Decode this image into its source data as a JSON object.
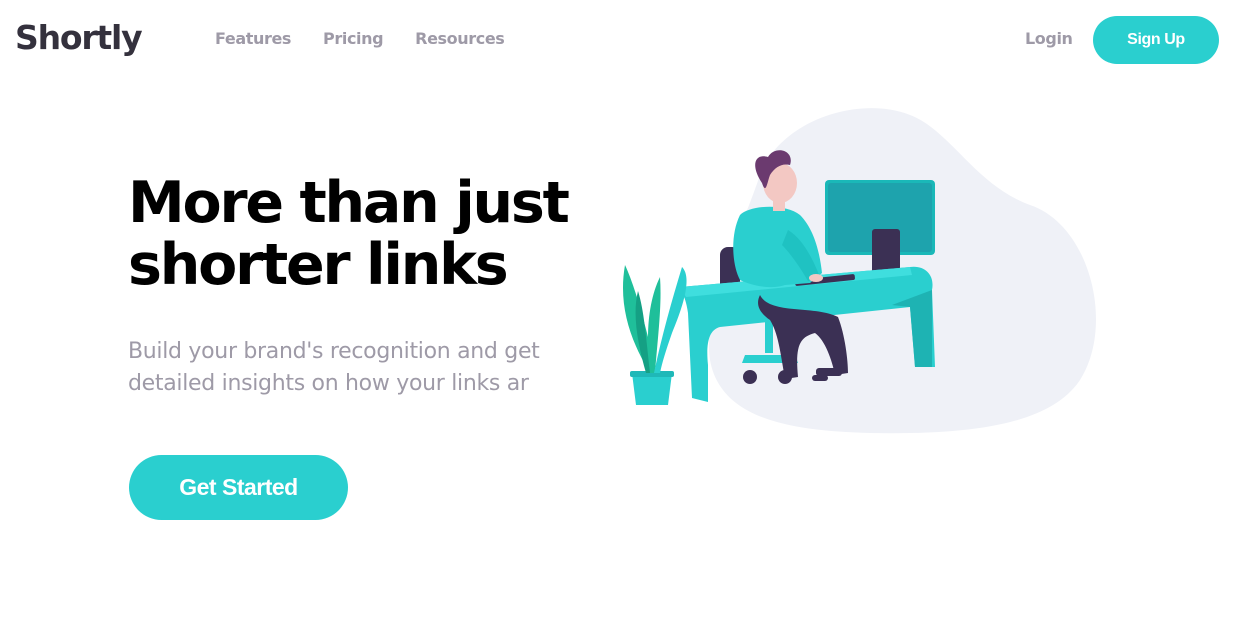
{
  "brand": {
    "name": "Shortly",
    "accent_color": "#2acfcf",
    "text_dark": "#34313d",
    "text_gray": "#9e9aa7"
  },
  "nav": {
    "links": [
      "Features",
      "Pricing",
      "Resources"
    ],
    "login_label": "Login",
    "signup_label": "Sign Up"
  },
  "hero": {
    "title": "More than just shorter links",
    "subtitle": "Build your brand's recognition and get detailed insights on how your links ar",
    "cta_label": "Get Started",
    "illustration": "person-working-at-desk-illustration"
  }
}
